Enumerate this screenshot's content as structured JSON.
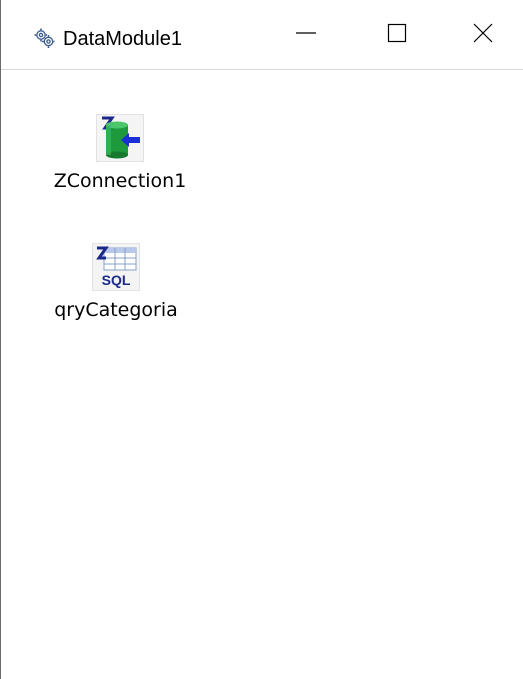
{
  "window": {
    "title": "DataModule1",
    "app_icon": "gear-cluster-icon",
    "controls": {
      "minimize_icon": "minimize-icon",
      "maximize_icon": "maximize-icon",
      "close_icon": "close-icon"
    }
  },
  "components": [
    {
      "label": "ZConnection1",
      "icon": "zeos-connection-icon"
    },
    {
      "label": "qryCategoria",
      "icon": "zeos-sql-query-icon",
      "icon_text": "SQL"
    }
  ],
  "colors": {
    "connection_green": "#1e9a3c",
    "connection_arrow": "#1a2fd6",
    "sql_text": "#1b2a8a"
  }
}
